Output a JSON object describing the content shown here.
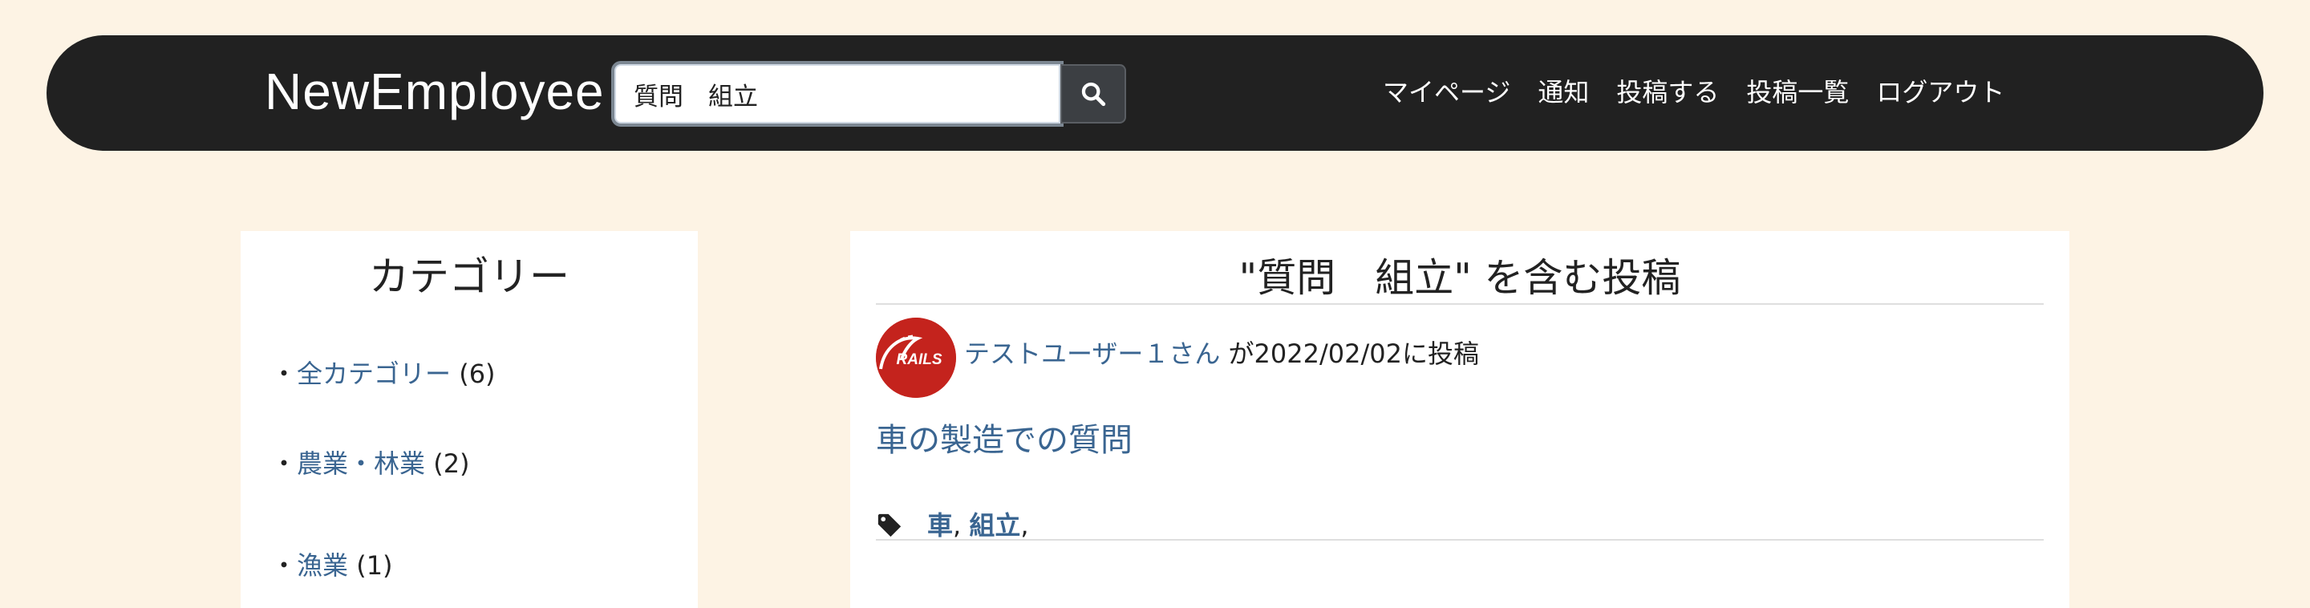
{
  "navbar": {
    "brand": "NewEmployee",
    "search_value": "質問　組立",
    "links": [
      "マイページ",
      "通知",
      "投稿する",
      "投稿一覧",
      "ログアウト"
    ]
  },
  "sidebar": {
    "title": "カテゴリー",
    "bullet": "・",
    "categories": [
      {
        "label": "全カテゴリー",
        "count": "(6)"
      },
      {
        "label": "農業・林業",
        "count": "(2)"
      },
      {
        "label": "漁業",
        "count": "(1)"
      }
    ]
  },
  "main": {
    "heading": "\"質問　組立\" を含む投稿",
    "post": {
      "avatar_text": "RAILS",
      "author": "テストユーザー１さん",
      "posted_text": " が2022/02/02に投稿",
      "title": "車の製造での質問",
      "tags": [
        "車",
        "組立"
      ]
    }
  },
  "colors": {
    "background": "#fdf3e4",
    "navbar": "#212121",
    "link": "#3a6591",
    "avatar": "#c4231d"
  }
}
